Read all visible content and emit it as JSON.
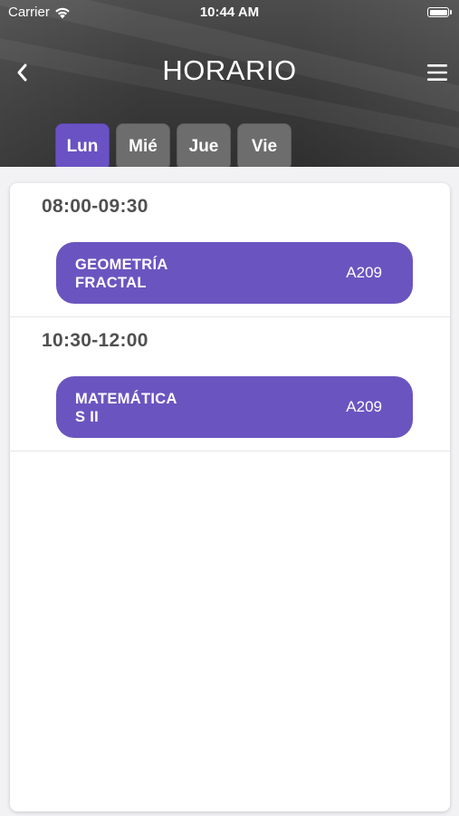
{
  "status_bar": {
    "carrier": "Carrier",
    "time": "10:44 AM"
  },
  "header": {
    "title": "HORARIO",
    "back_icon": "chevron-left-icon",
    "menu_icon": "hamburger-menu-icon"
  },
  "day_tabs": [
    {
      "label": "Lun",
      "active": true
    },
    {
      "label": "Mié",
      "active": false
    },
    {
      "label": "Jue",
      "active": false
    },
    {
      "label": "Vie",
      "active": false
    }
  ],
  "schedule": [
    {
      "time": "08:00-09:30",
      "class": {
        "name": "GEOMETRÍA\nFRACTAL",
        "room": "A209"
      }
    },
    {
      "time": "10:30-12:00",
      "class": {
        "name": "MATEMÁTICA\nS II",
        "room": "A209"
      }
    }
  ],
  "colors": {
    "accent": "#6a52c4",
    "tab_inactive": "#6d6d6d",
    "time_text": "#505050"
  }
}
